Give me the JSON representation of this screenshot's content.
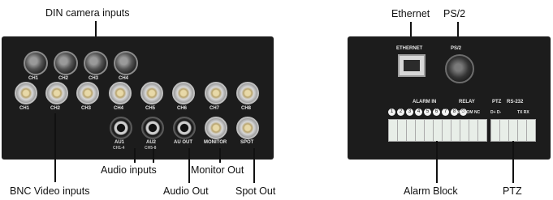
{
  "callouts": {
    "din_camera_inputs": "DIN camera inputs",
    "bnc_video_inputs": "BNC Video inputs",
    "audio_inputs": "Audio inputs",
    "audio_out": "Audio Out",
    "monitor_out": "Monitor Out",
    "spot_out": "Spot Out",
    "ethernet": "Ethernet",
    "ps2": "PS/2",
    "alarm_block": "Alarm Block",
    "ptz": "PTZ"
  },
  "left_panel": {
    "din_labels": [
      "CH1",
      "CH2",
      "CH3",
      "CH4"
    ],
    "bnc_labels": [
      "CH1",
      "CH2",
      "CH3",
      "CH4",
      "CH5",
      "CH6",
      "CH7",
      "CH8"
    ],
    "au1": "AU1",
    "au1_sub": "CH1-4",
    "au2": "AU2",
    "au2_sub": "CH5-8",
    "au_out": "AU OUT",
    "monitor": "MONITOR",
    "spot": "SPOT"
  },
  "right_panel": {
    "ethernet": "ETHERNET",
    "ps2": "PS/2",
    "alarm_in": "ALARM IN",
    "relay": "RELAY",
    "relay_pins": "NO COM NC",
    "alarm_numbers": [
      "1",
      "2",
      "3",
      "4",
      "5",
      "6",
      "7",
      "8",
      "G"
    ],
    "ptz": "PTZ",
    "rs232": "RS-232",
    "ptz_pins": "D+ D-",
    "rs232_pins": "TX RX"
  }
}
